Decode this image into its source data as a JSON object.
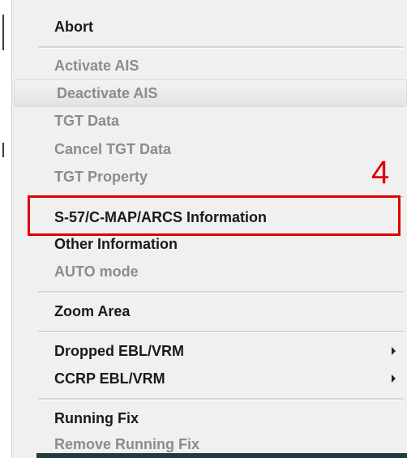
{
  "menu": {
    "items": [
      {
        "label": "Abort",
        "disabled": false
      },
      {
        "label": "Activate AIS",
        "disabled": true
      },
      {
        "label": "Deactivate AIS",
        "disabled": true
      },
      {
        "label": "TGT Data",
        "disabled": true
      },
      {
        "label": "Cancel TGT Data",
        "disabled": true
      },
      {
        "label": "TGT Property",
        "disabled": true
      },
      {
        "label": "S-57/C-MAP/ARCS Information",
        "disabled": false
      },
      {
        "label": "Other Information",
        "disabled": false
      },
      {
        "label": "AUTO mode",
        "disabled": true
      },
      {
        "label": "Zoom Area",
        "disabled": false
      },
      {
        "label": "Dropped EBL/VRM",
        "disabled": false,
        "submenu": true
      },
      {
        "label": "CCRP EBL/VRM",
        "disabled": false,
        "submenu": true
      },
      {
        "label": "Running Fix",
        "disabled": false
      },
      {
        "label": "Remove Running Fix",
        "disabled": true
      }
    ]
  },
  "annotation": {
    "step_number": "4",
    "highlight_color": "#e00000"
  },
  "colors": {
    "menu_background": "#f0f0f0",
    "enabled_text": "#1a1a1a",
    "disabled_text": "#8c8c8c"
  }
}
